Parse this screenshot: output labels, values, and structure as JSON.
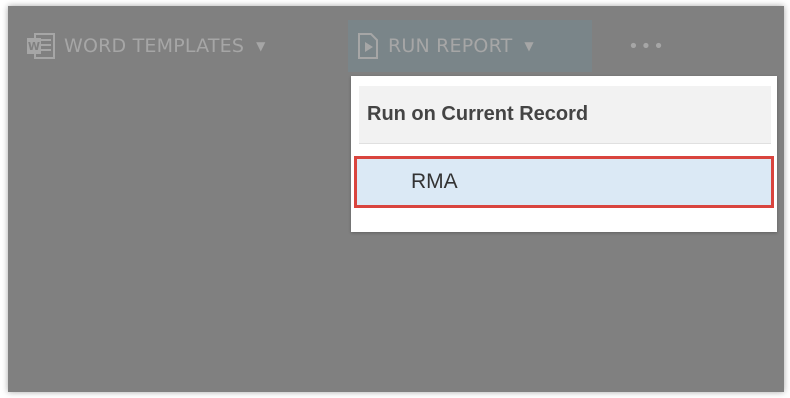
{
  "toolbar": {
    "word_templates": {
      "label": "WORD TEMPLATES",
      "icon": "word-doc-icon"
    },
    "run_report": {
      "label": "RUN REPORT",
      "icon": "report-icon"
    },
    "more": {
      "label": "•••"
    }
  },
  "dropdown": {
    "header": "Run on Current Record",
    "items": [
      {
        "label": "RMA"
      }
    ]
  },
  "colors": {
    "overlay": "#808080",
    "highlight_border": "#d9443e",
    "item_bg": "#dbe9f5"
  }
}
